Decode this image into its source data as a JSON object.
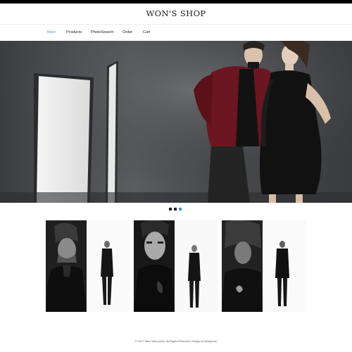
{
  "header": {
    "title": "WON'S SHOP"
  },
  "nav": {
    "items": [
      {
        "label": "Main",
        "active": true
      },
      {
        "label": "Products",
        "active": false
      },
      {
        "label": "PhotoSearch",
        "active": false
      },
      {
        "label": "Order",
        "active": false
      },
      {
        "label": "Cart",
        "active": false
      }
    ]
  },
  "carousel": {
    "slide_count": 3,
    "active_index": 2
  },
  "products": [
    {
      "portrait_style": "shadowed-face"
    },
    {
      "portrait_style": "close-up-face"
    },
    {
      "portrait_style": "hooded-face"
    }
  ],
  "footer": {
    "text": "© 2017 Team Won-photo. All Rights Reserved | Design by W3layouts"
  },
  "colors": {
    "accent": "#4e9fe0",
    "active_dot": "#4e8fcf",
    "top_strip": "#000000"
  }
}
